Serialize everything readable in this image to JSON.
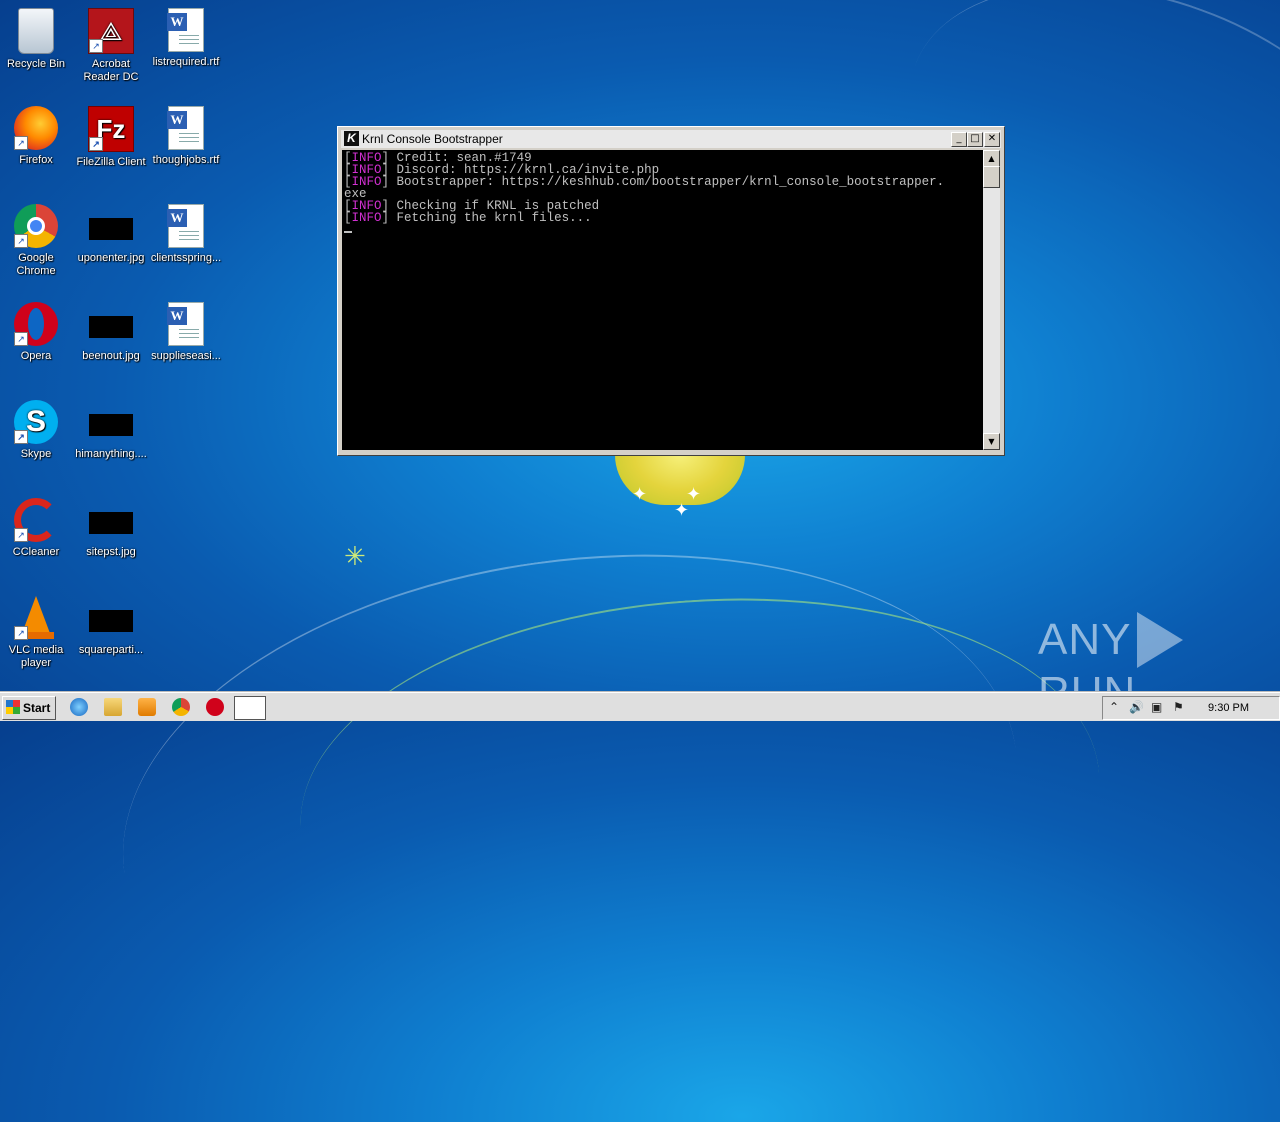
{
  "desktop": {
    "icons": [
      {
        "label": "Recycle Bin",
        "icon": "recycle-bin-icon"
      },
      {
        "label": "Acrobat Reader DC",
        "icon": "acrobat-icon"
      },
      {
        "label": "listrequired.rtf",
        "icon": "word-doc-icon"
      },
      {
        "label": "Firefox",
        "icon": "firefox-icon"
      },
      {
        "label": "FileZilla Client",
        "icon": "filezilla-icon"
      },
      {
        "label": "thoughjobs.rtf",
        "icon": "word-doc-icon"
      },
      {
        "label": "Google Chrome",
        "icon": "chrome-icon"
      },
      {
        "label": "uponenter.jpg",
        "icon": "image-thumb-icon"
      },
      {
        "label": "clientsspring...",
        "icon": "word-doc-icon"
      },
      {
        "label": "Opera",
        "icon": "opera-icon"
      },
      {
        "label": "beenout.jpg",
        "icon": "image-thumb-icon"
      },
      {
        "label": "supplieseasi...",
        "icon": "word-doc-icon"
      },
      {
        "label": "Skype",
        "icon": "skype-icon"
      },
      {
        "label": "himanything....",
        "icon": "image-thumb-icon"
      },
      {
        "label": "CCleaner",
        "icon": "ccleaner-icon"
      },
      {
        "label": "sitepst.jpg",
        "icon": "image-thumb-icon"
      },
      {
        "label": "VLC media player",
        "icon": "vlc-icon"
      },
      {
        "label": "squareparti...",
        "icon": "image-thumb-icon"
      }
    ]
  },
  "console_window": {
    "title": "Krnl Console Bootstrapper",
    "title_icon": "K",
    "buttons": {
      "minimize": "_",
      "maximize": "□",
      "close": "✕"
    },
    "lines": [
      {
        "tag": "INFO",
        "text": " Credit: sean.#1749"
      },
      {
        "tag": "INFO",
        "text": " Discord: https://krnl.ca/invite.php"
      },
      {
        "tag": "INFO",
        "text": " Bootstrapper: https://keshhub.com/bootstrapper/krnl_console_bootstrapper."
      },
      {
        "tag": "",
        "text": "exe"
      },
      {
        "tag": "INFO",
        "text": " Checking if KRNL is patched"
      },
      {
        "tag": "INFO",
        "text": " Fetching the krnl files..."
      }
    ]
  },
  "taskbar": {
    "start_label": "Start",
    "pinned": [
      "ie-icon",
      "explorer-icon",
      "media-player-icon",
      "chrome-icon",
      "opera-icon"
    ],
    "tray_icons": [
      "show-hidden-icon",
      "volume-icon",
      "network-icon",
      "flag-icon"
    ],
    "clock": "9:30 PM"
  },
  "watermark": {
    "left": "ANY",
    "right": "RUN"
  },
  "colors": {
    "desktop_blue": "#0f7fd0",
    "console_bg": "#000000",
    "console_text": "#c0c0c0",
    "info_tag": "#d030d0"
  }
}
